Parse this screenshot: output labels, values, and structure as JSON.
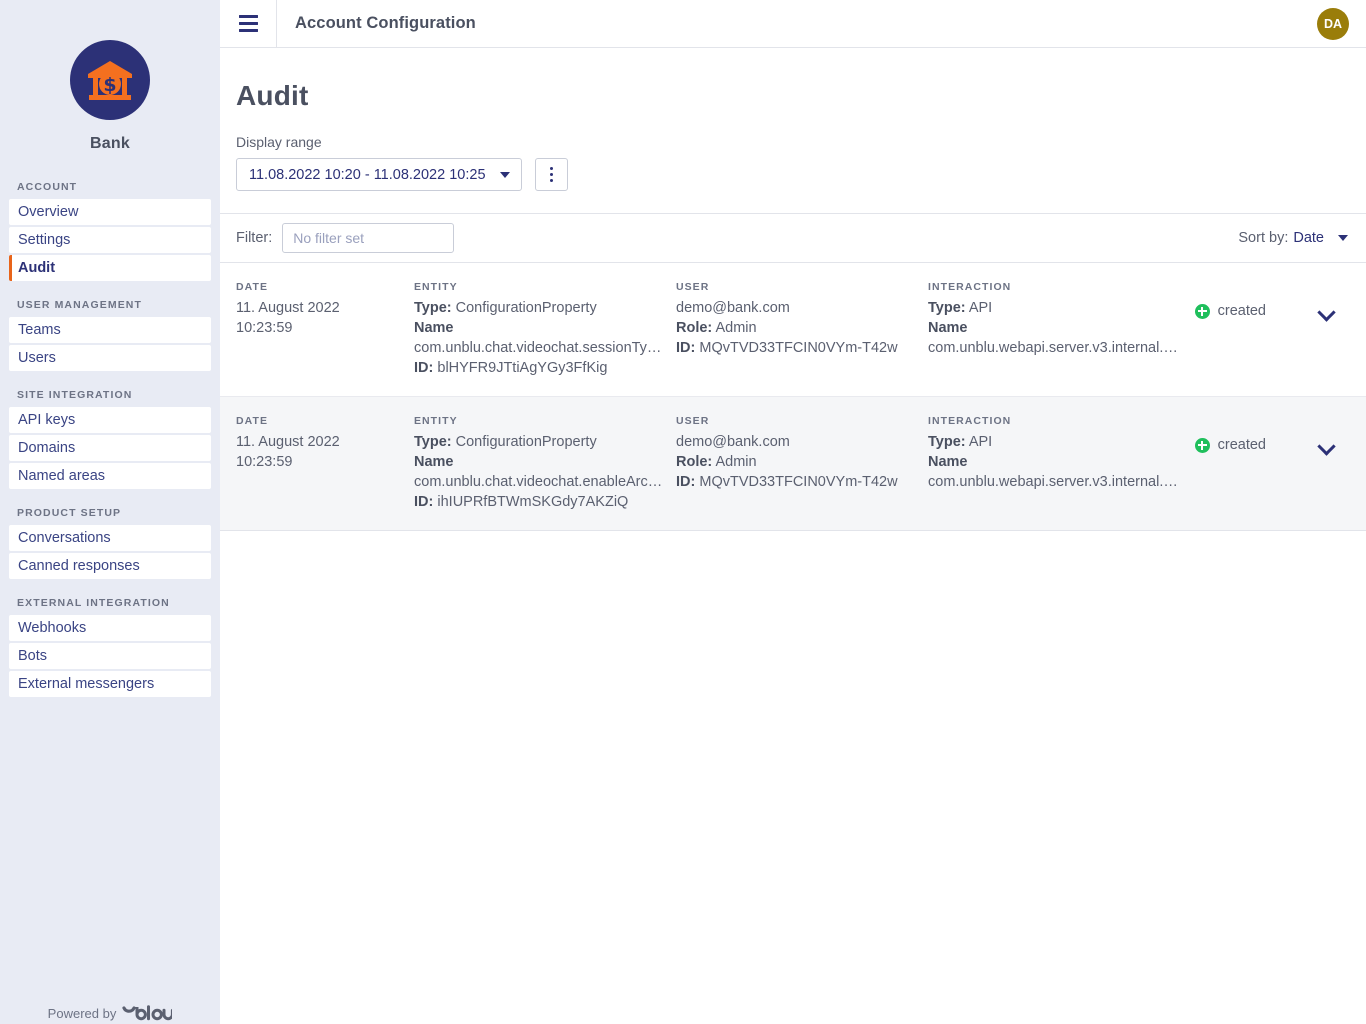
{
  "sidebar": {
    "brand_name": "Bank",
    "logo_icon": "bank-building-icon",
    "footer_prefix": "Powered by",
    "footer_brand": "unblu",
    "groups": [
      {
        "label": "ACCOUNT",
        "items": [
          {
            "label": "Overview",
            "active": false
          },
          {
            "label": "Settings",
            "active": false
          },
          {
            "label": "Audit",
            "active": true
          }
        ]
      },
      {
        "label": "USER MANAGEMENT",
        "items": [
          {
            "label": "Teams",
            "active": false
          },
          {
            "label": "Users",
            "active": false
          }
        ]
      },
      {
        "label": "SITE INTEGRATION",
        "items": [
          {
            "label": "API keys",
            "active": false
          },
          {
            "label": "Domains",
            "active": false
          },
          {
            "label": "Named areas",
            "active": false
          }
        ]
      },
      {
        "label": "PRODUCT SETUP",
        "items": [
          {
            "label": "Conversations",
            "active": false
          },
          {
            "label": "Canned responses",
            "active": false
          }
        ]
      },
      {
        "label": "EXTERNAL INTEGRATION",
        "items": [
          {
            "label": "Webhooks",
            "active": false
          },
          {
            "label": "Bots",
            "active": false
          },
          {
            "label": "External messengers",
            "active": false
          }
        ]
      }
    ]
  },
  "topbar": {
    "menu_icon": "hamburger-icon",
    "title": "Account Configuration",
    "avatar_initials": "DA"
  },
  "page": {
    "title": "Audit",
    "display_range_label": "Display range",
    "display_range_value": "11.08.2022 10:20 - 11.08.2022 10:25",
    "more_menu_icon": "kebab-menu-icon",
    "filter_label": "Filter:",
    "filter_value": "",
    "filter_placeholder": "No filter set",
    "sort_label": "Sort by:",
    "sort_value": "Date"
  },
  "table": {
    "headers": {
      "date": "DATE",
      "entity": "ENTITY",
      "user": "USER",
      "interaction": "INTERACTION"
    },
    "field_labels": {
      "type": "Type:",
      "name": "Name",
      "id": "ID:",
      "role": "Role:"
    },
    "rows": [
      {
        "date": "11. August 2022",
        "time": "10:23:59",
        "entity_type": "ConfigurationProperty",
        "entity_name": "com.unblu.chat.videochat.sessionTy…",
        "entity_id": "blHYFR9JTtiAgYGy3FfKig",
        "user_email": "demo@bank.com",
        "user_role": "Admin",
        "user_id": "MQvTVD33TFCIN0VYm-T42w",
        "interaction_type": "API",
        "interaction_name": "com.unblu.webapi.server.v3.internal.…",
        "status": "created",
        "status_icon": "plus-circle-icon",
        "expand_icon": "chevron-down-icon"
      },
      {
        "date": "11. August 2022",
        "time": "10:23:59",
        "entity_type": "ConfigurationProperty",
        "entity_name": "com.unblu.chat.videochat.enableArc…",
        "entity_id": "ihIUPRfBTWmSKGdy7AKZiQ",
        "user_email": "demo@bank.com",
        "user_role": "Admin",
        "user_id": "MQvTVD33TFCIN0VYm-T42w",
        "interaction_type": "API",
        "interaction_name": "com.unblu.webapi.server.v3.internal.…",
        "status": "created",
        "status_icon": "plus-circle-icon",
        "expand_icon": "chevron-down-icon"
      }
    ]
  },
  "colors": {
    "sidebar_bg": "#e8ebf4",
    "brand_navy": "#2c3177",
    "accent_orange": "#e8641a",
    "status_green": "#1fbf5c",
    "avatar_bg": "#9a7d0a"
  }
}
